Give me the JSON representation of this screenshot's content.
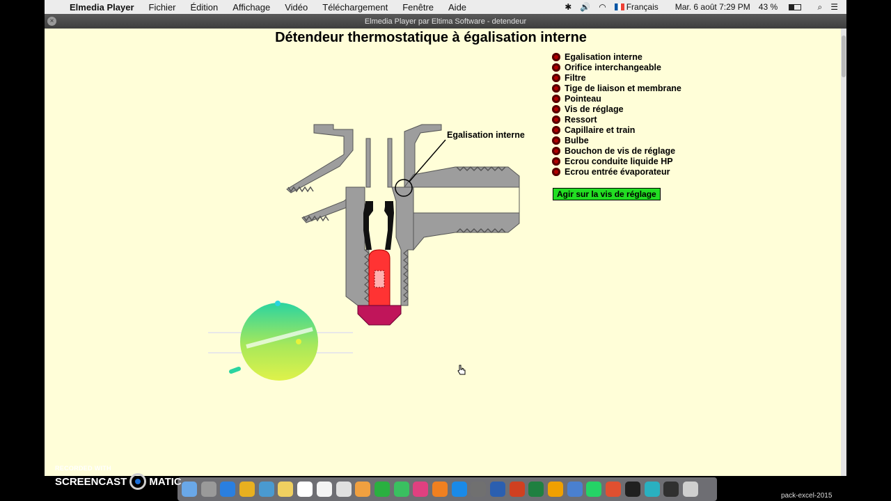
{
  "menubar": {
    "app_name": "Elmedia Player",
    "items": [
      "Fichier",
      "Édition",
      "Affichage",
      "Vidéo",
      "Téléchargement",
      "Fenêtre",
      "Aide"
    ],
    "language": "Français",
    "datetime": "Mar. 6 août 7:29 PM",
    "battery": "43 %"
  },
  "window": {
    "title": "Elmedia Player par Eltima Software - detendeur"
  },
  "content": {
    "title": "Détendeur thermostatique à égalisation interne",
    "callout_label": "Egalisation interne",
    "legend": [
      "Egalisation interne",
      "Orifice interchangeable",
      "Filtre",
      "Tige de liaison et membrane",
      "Pointeau",
      "Vis de réglage",
      "Ressort",
      "Capillaire et train",
      "Bulbe",
      "Bouchon de vis de réglage",
      "Ecrou conduite liquide HP",
      "Ecrou entrée évaporateur"
    ],
    "action_button": "Agir sur la vis de réglage"
  },
  "watermark": {
    "recorded": "RECORDED WITH",
    "brand_left": "SCREENCAST",
    "brand_right": "MATIC"
  },
  "dock_label": "pack-excel-2015",
  "colors": {
    "background": "#fffed8",
    "metal": "#9d9d9d",
    "red_part": "#ff3333",
    "cap": "#c0155a",
    "legend_dot": "#b00000",
    "button": "#22dd22"
  },
  "dock_icons": [
    "finder",
    "launchpad",
    "safari",
    "chrome",
    "preview",
    "notes",
    "calendar",
    "textedit",
    "reminders",
    "photos",
    "messages",
    "facetime",
    "itunes",
    "books",
    "appstore",
    "system-preferences",
    "word",
    "powerpoint",
    "excel",
    "app-orange",
    "app-blue",
    "whatsapp",
    "app-red",
    "app-dark",
    "app-teal",
    "screenshot",
    "trash"
  ]
}
